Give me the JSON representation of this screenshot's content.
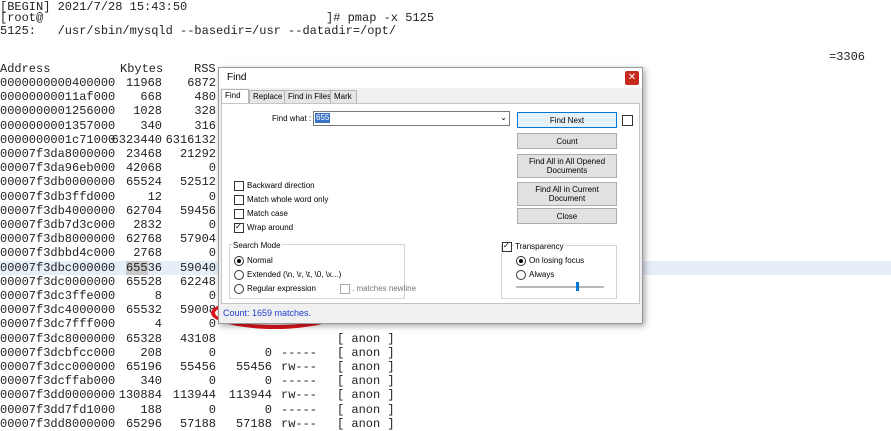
{
  "terminal": {
    "begin_line": "[BEGIN] 2021/7/28 15:43:50",
    "prompt_user": "[root@",
    "prompt_cmd": "]# pmap -x 5125",
    "process_line": "5125:   /usr/sbin/mysqld --basedir=/usr --datadir=/opt/",
    "right_fragment": "=3306",
    "headers": {
      "address": "Address",
      "kbytes": "Kbytes",
      "rss": "RSS"
    },
    "rows": [
      {
        "address": "0000000000400000",
        "kbytes": "11968",
        "rss": "6872",
        "dirty": "",
        "mode": "",
        "mapping": ""
      },
      {
        "address": "00000000011af000",
        "kbytes": "668",
        "rss": "480",
        "dirty": "",
        "mode": "",
        "mapping": ""
      },
      {
        "address": "0000000001256000",
        "kbytes": "1028",
        "rss": "328",
        "dirty": "",
        "mode": "",
        "mapping": ""
      },
      {
        "address": "0000000001357000",
        "kbytes": "340",
        "rss": "316",
        "dirty": "",
        "mode": "",
        "mapping": ""
      },
      {
        "address": "0000000001c71000",
        "kbytes": "6323440",
        "rss": "6316132",
        "dirty": "",
        "mode": "",
        "mapping": ""
      },
      {
        "address": "00007f3da8000000",
        "kbytes": "23468",
        "rss": "21292",
        "dirty": "",
        "mode": "",
        "mapping": ""
      },
      {
        "address": "00007f3da96eb000",
        "kbytes": "42068",
        "rss": "0",
        "dirty": "",
        "mode": "",
        "mapping": ""
      },
      {
        "address": "00007f3db0000000",
        "kbytes": "65524",
        "rss": "52512",
        "dirty": "",
        "mode": "",
        "mapping": ""
      },
      {
        "address": "00007f3db3ffd000",
        "kbytes": "12",
        "rss": "0",
        "dirty": "",
        "mode": "",
        "mapping": ""
      },
      {
        "address": "00007f3db4000000",
        "kbytes": "62704",
        "rss": "59456",
        "dirty": "",
        "mode": "",
        "mapping": ""
      },
      {
        "address": "00007f3db7d3c000",
        "kbytes": "2832",
        "rss": "0",
        "dirty": "",
        "mode": "",
        "mapping": ""
      },
      {
        "address": "00007f3db8000000",
        "kbytes": "62768",
        "rss": "57904",
        "dirty": "",
        "mode": "",
        "mapping": ""
      },
      {
        "address": "00007f3dbbd4c000",
        "kbytes": "2768",
        "rss": "0",
        "dirty": "",
        "mode": "",
        "mapping": ""
      },
      {
        "address": "00007f3dbc000000",
        "kbytes": "65536",
        "kbytes_hl": "655",
        "kbytes_rest": "36",
        "rss": "59040",
        "dirty": "",
        "mode": "",
        "mapping": "",
        "selected": true
      },
      {
        "address": "00007f3dc0000000",
        "kbytes": "65528",
        "rss": "62248",
        "dirty": "",
        "mode": "",
        "mapping": ""
      },
      {
        "address": "00007f3dc3ffe000",
        "kbytes": "8",
        "rss": "0",
        "dirty": "",
        "mode": "",
        "mapping": ""
      },
      {
        "address": "00007f3dc4000000",
        "kbytes": "65532",
        "rss": "59008",
        "dirty": "",
        "mode": "",
        "mapping": ""
      },
      {
        "address": "00007f3dc7fff000",
        "kbytes": "4",
        "rss": "0",
        "dirty": "",
        "mode": "",
        "mapping": ""
      },
      {
        "address": "00007f3dc8000000",
        "kbytes": "65328",
        "rss": "43108",
        "dirty": "",
        "mode": "",
        "mapping": "[ anon ]"
      },
      {
        "address": "00007f3dcbfcc000",
        "kbytes": "208",
        "rss": "0",
        "dirty": "0",
        "mode": "-----",
        "mapping": "[ anon ]"
      },
      {
        "address": "00007f3dcc000000",
        "kbytes": "65196",
        "rss": "55456",
        "dirty": "55456",
        "mode": "rw---",
        "mapping": "[ anon ]"
      },
      {
        "address": "00007f3dcffab000",
        "kbytes": "340",
        "rss": "0",
        "dirty": "0",
        "mode": "-----",
        "mapping": "[ anon ]"
      },
      {
        "address": "00007f3dd0000000",
        "kbytes": "130884",
        "rss": "113944",
        "dirty": "113944",
        "mode": "rw---",
        "mapping": "[ anon ]"
      },
      {
        "address": "00007f3dd7fd1000",
        "kbytes": "188",
        "rss": "0",
        "dirty": "0",
        "mode": "-----",
        "mapping": "[ anon ]"
      },
      {
        "address": "00007f3dd8000000",
        "kbytes": "65296",
        "rss": "57188",
        "dirty": "57188",
        "mode": "rw---",
        "mapping": "[ anon ]"
      }
    ]
  },
  "dialog": {
    "title": "Find",
    "close_glyph": "✕",
    "tabs": [
      {
        "label": "Find",
        "active": true
      },
      {
        "label": "Replace",
        "active": false
      },
      {
        "label": "Find in Files",
        "active": false
      },
      {
        "label": "Mark",
        "active": false
      }
    ],
    "find_what_label": "Find what :",
    "find_what_value": "655",
    "combo_arrow": "⌄",
    "buttons": {
      "find_next": "Find Next",
      "count": "Count",
      "find_all_opened": "Find All in All Opened Documents",
      "find_all_current": "Find All in Current Document",
      "close": "Close"
    },
    "options": {
      "backward": "Backward direction",
      "whole_word": "Match whole word only",
      "match_case": "Match case",
      "wrap_around": "Wrap around"
    },
    "search_mode": {
      "title": "Search Mode",
      "normal": "Normal",
      "extended": "Extended (\\n, \\r, \\t, \\0, \\x...)",
      "regex": "Regular expression",
      "matches_newline": ". matches newline"
    },
    "transparency": {
      "title": "Transparency",
      "on_losing_focus": "On losing focus",
      "always": "Always",
      "level": 0.68
    },
    "status": "Count: 1659 matches."
  }
}
